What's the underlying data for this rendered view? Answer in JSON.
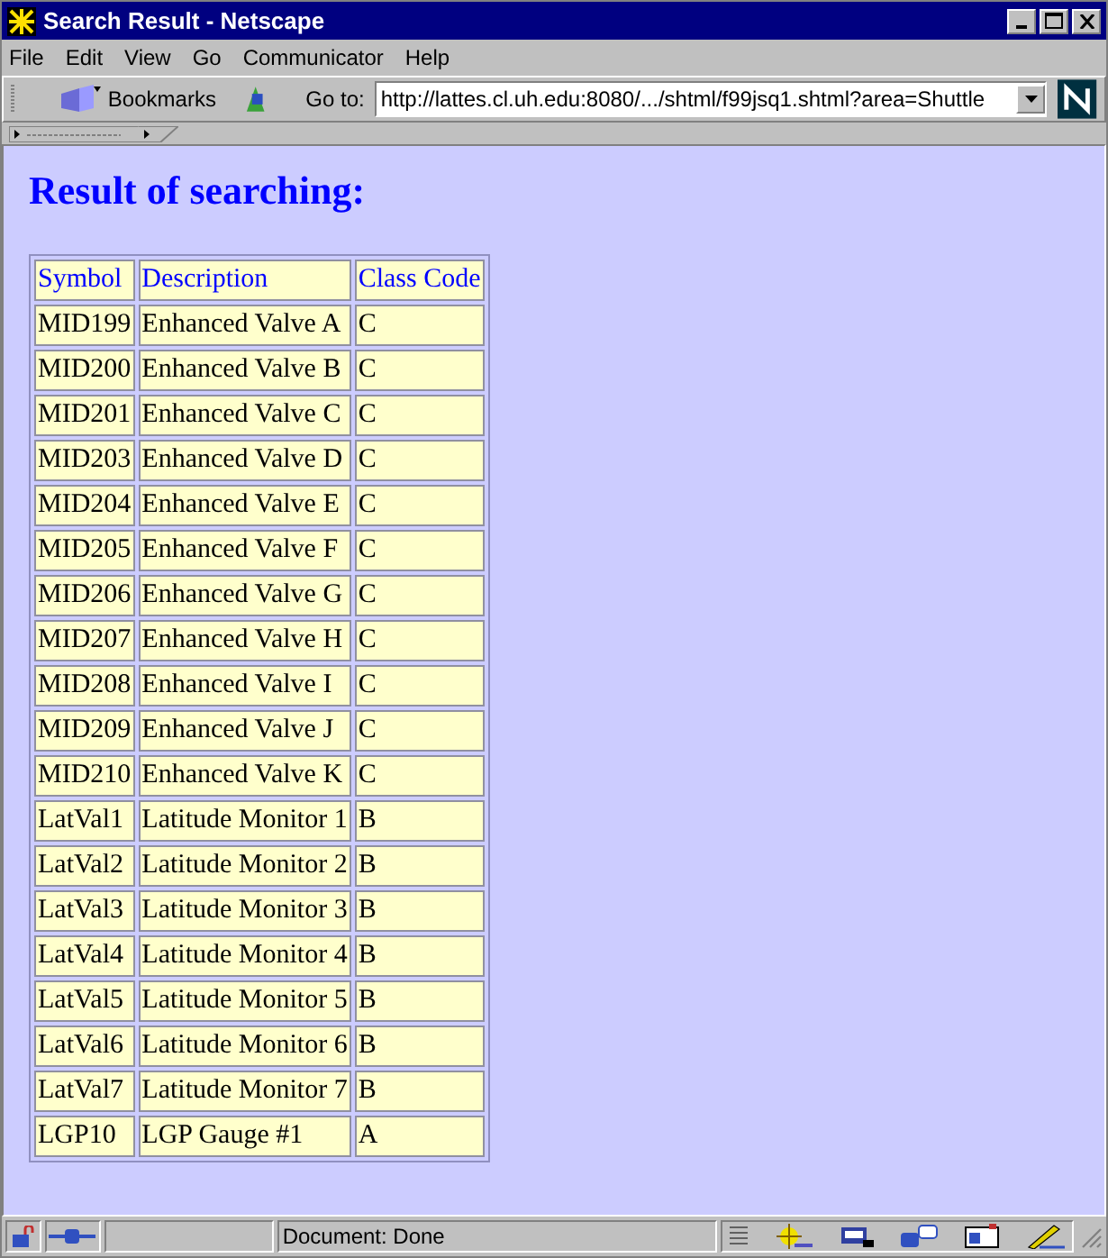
{
  "window": {
    "title": "Search Result - Netscape"
  },
  "menu": [
    "File",
    "Edit",
    "View",
    "Go",
    "Communicator",
    "Help"
  ],
  "toolbar": {
    "bookmarks": "Bookmarks",
    "goto_label": "Go to:",
    "url": "http://lattes.cl.uh.edu:8080/.../shtml/f99jsq1.shtml?area=Shuttle"
  },
  "heading": "Result of searching:",
  "table": {
    "columns": [
      "Symbol",
      "Description",
      "Class Code"
    ],
    "rows": [
      [
        "MID199",
        "Enhanced Valve A",
        "C"
      ],
      [
        "MID200",
        "Enhanced Valve B",
        "C"
      ],
      [
        "MID201",
        "Enhanced Valve C",
        "C"
      ],
      [
        "MID203",
        "Enhanced Valve D",
        "C"
      ],
      [
        "MID204",
        "Enhanced Valve E",
        "C"
      ],
      [
        "MID205",
        "Enhanced Valve F",
        "C"
      ],
      [
        "MID206",
        "Enhanced Valve G",
        "C"
      ],
      [
        "MID207",
        "Enhanced Valve H",
        "C"
      ],
      [
        "MID208",
        "Enhanced Valve I",
        "C"
      ],
      [
        "MID209",
        "Enhanced Valve J",
        "C"
      ],
      [
        "MID210",
        "Enhanced Valve K",
        "C"
      ],
      [
        "LatVal1",
        "Latitude Monitor 1",
        "B"
      ],
      [
        "LatVal2",
        "Latitude Monitor 2",
        "B"
      ],
      [
        "LatVal3",
        "Latitude Monitor 3",
        "B"
      ],
      [
        "LatVal4",
        "Latitude Monitor 4",
        "B"
      ],
      [
        "LatVal5",
        "Latitude Monitor 5",
        "B"
      ],
      [
        "LatVal6",
        "Latitude Monitor 6",
        "B"
      ],
      [
        "LatVal7",
        "Latitude Monitor 7",
        "B"
      ],
      [
        "LGP10",
        "LGP Gauge #1",
        "A"
      ]
    ]
  },
  "status_bar": {
    "text": "Document: Done"
  }
}
